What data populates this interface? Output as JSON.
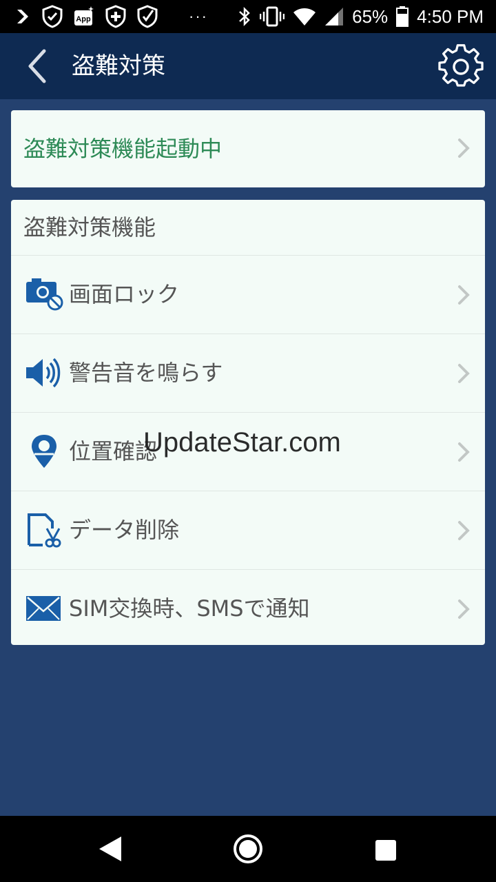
{
  "status_bar": {
    "battery_percent": "65%",
    "time": "4:50 PM",
    "notification_icons": [
      "chevron-icon",
      "shield-check-icon",
      "app-badge-icon",
      "shield-plus-icon",
      "shield-check-icon"
    ],
    "app_badge_text": "App",
    "more_dots": "···"
  },
  "app_bar": {
    "title": "盗難対策"
  },
  "status_card": {
    "text": "盗難対策機能起動中",
    "color": "#2d8a56"
  },
  "features": {
    "header": "盗難対策機能",
    "items": [
      {
        "label": "画面ロック",
        "icon": "camera-lock-icon"
      },
      {
        "label": "警告音を鳴らす",
        "icon": "speaker-icon"
      },
      {
        "label": "位置確認",
        "icon": "location-pin-icon"
      },
      {
        "label": "データ削除",
        "icon": "data-wipe-icon"
      },
      {
        "label": "SIM交換時、SMSで通知",
        "icon": "envelope-icon"
      }
    ]
  },
  "watermark": "UpdateStar.com",
  "colors": {
    "background": "#24416f",
    "app_bar": "#0e2a52",
    "card": "#f3fbf7",
    "icon_blue": "#1a5fa8"
  }
}
